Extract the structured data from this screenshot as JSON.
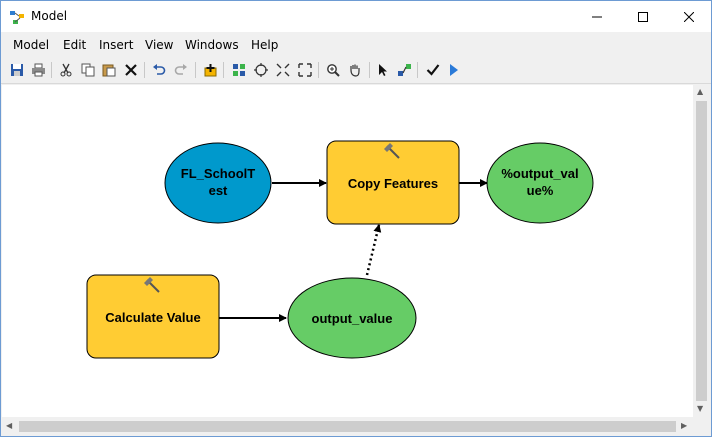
{
  "window": {
    "title": "Model",
    "app_icon": "model-builder-icon"
  },
  "menu": {
    "items": [
      "Model",
      "Edit",
      "Insert",
      "View",
      "Windows",
      "Help"
    ]
  },
  "toolbar": {
    "icons": [
      "save-icon",
      "print-icon",
      "cut-icon",
      "copy-icon",
      "paste-icon",
      "delete-icon",
      "undo-icon",
      "redo-icon",
      "add-data-icon",
      "auto-layout-icon",
      "full-extent-icon",
      "zoom-in-fixed-icon",
      "zoom-out-fixed-icon",
      "zoom-icon",
      "pan-icon",
      "select-icon",
      "connect-icon",
      "validate-icon",
      "run-icon"
    ]
  },
  "diagram": {
    "nodes": [
      {
        "id": "fl_school",
        "line1": "FL_SchoolT",
        "line2": "est",
        "kind": "input-data",
        "color": "#0099cc"
      },
      {
        "id": "copy_features",
        "line1": "Copy Features",
        "line2": "",
        "kind": "tool",
        "color": "#ffcc33"
      },
      {
        "id": "output_val_pct",
        "line1": "%output_val",
        "line2": "ue%",
        "kind": "output-data",
        "color": "#66cc66"
      },
      {
        "id": "calculate_value",
        "line1": "Calculate Value",
        "line2": "",
        "kind": "tool",
        "color": "#ffcc33"
      },
      {
        "id": "output_value",
        "line1": "output_value",
        "line2": "",
        "kind": "derived-data",
        "color": "#66cc66"
      }
    ],
    "connections": [
      {
        "from": "fl_school",
        "to": "copy_features",
        "style": "solid"
      },
      {
        "from": "copy_features",
        "to": "output_val_pct",
        "style": "solid"
      },
      {
        "from": "calculate_value",
        "to": "output_value",
        "style": "solid"
      },
      {
        "from": "output_value",
        "to": "copy_features",
        "style": "dotted"
      }
    ]
  }
}
